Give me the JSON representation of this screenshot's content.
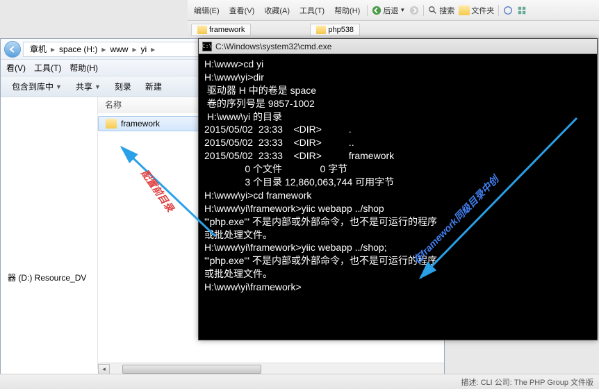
{
  "top_menu": {
    "items": [
      "编辑(E)",
      "查看(V)",
      "收藏(A)",
      "工具(T)",
      "帮助(H)"
    ],
    "back": "后退",
    "search": "搜索",
    "folders": "文件夹"
  },
  "top_tabs": {
    "tab1": "framework",
    "tab2": "php538"
  },
  "explorer": {
    "breadcrumb": {
      "seg1": "章机",
      "seg2": "space (H:)",
      "seg3": "www",
      "seg4": "yi"
    },
    "menu": {
      "view": "看(V)",
      "tools": "工具(T)",
      "help": "帮助(H)"
    },
    "toolbar": {
      "include": "包含到库中",
      "share": "共享",
      "burn": "刻录",
      "new": "新建"
    },
    "tree": {
      "item1": "器 (D:) Resource_DV"
    },
    "list": {
      "header_name": "名称",
      "item1": "framework"
    }
  },
  "cmd": {
    "title": "C:\\Windows\\system32\\cmd.exe",
    "lines": [
      "H:\\www>cd yi",
      "",
      "H:\\www\\yi>dir",
      " 驱动器 H 中的卷是 space",
      " 卷的序列号是 9857-1002",
      "",
      " H:\\www\\yi 的目录",
      "",
      "2015/05/02  23:33    <DIR>          .",
      "2015/05/02  23:33    <DIR>          ..",
      "2015/05/02  23:33    <DIR>          framework",
      "               0 个文件              0 字节",
      "               3 个目录 12,860,063,744 可用字节",
      "",
      "H:\\www\\yi>cd framework",
      "",
      "H:\\www\\yi\\framework>yiic webapp ../shop",
      "'\"php.exe\"' 不是内部或外部命令，也不是可运行的程序",
      "或批处理文件。",
      "",
      "H:\\www\\yi\\framework>yiic webapp ../shop;",
      "'\"php.exe\"' 不是内部或外部命令，也不是可运行的程序",
      "或批处理文件。",
      "",
      "H:\\www\\yi\\framework>"
    ]
  },
  "annotations": {
    "red_text": "配置前目录",
    "blue_text": "在framework同级目录中创"
  },
  "status_bar": {
    "text": "描述: CLI 公司: The PHP Group 文件版"
  }
}
